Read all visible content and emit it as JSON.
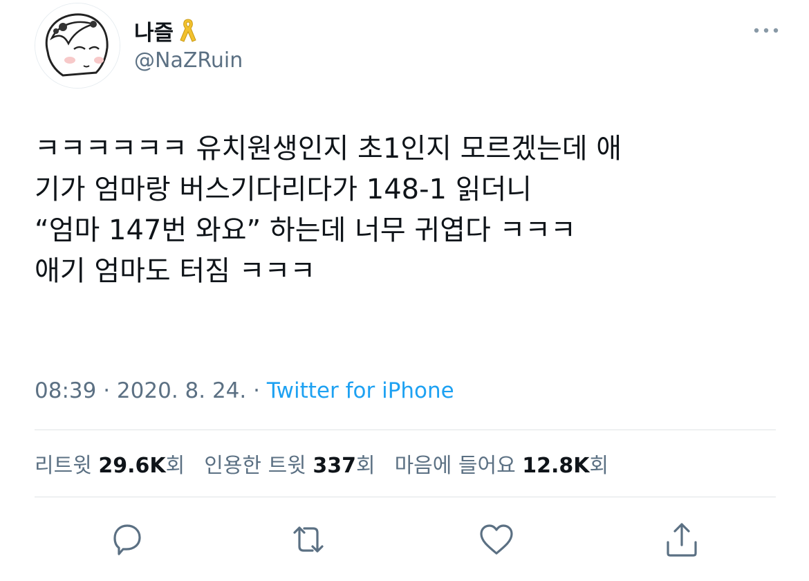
{
  "profile": {
    "display_name": "나즐",
    "handle": "@NaZRuin",
    "badge_icon": "yellow-ribbon-icon"
  },
  "tweet": {
    "lines": [
      "ㅋㅋㅋㅋㅋㅋ 유치원생인지 초1인지 모르겠는데 애",
      "기가 엄마랑 버스기다리다가 148-1 읽더니",
      "“엄마 147번 와요” 하는데 너무 귀엽다 ㅋㅋㅋ",
      "애기 엄마도 터짐 ㅋㅋㅋ"
    ]
  },
  "meta": {
    "time": "08:39",
    "separator": "·",
    "date": "2020. 8. 24.",
    "source": "Twitter for iPhone"
  },
  "stats": {
    "retweets_label": "리트윗",
    "retweets_count": "29.6K",
    "retweets_suffix": "회",
    "quotes_label": "인용한 트윗",
    "quotes_count": "337",
    "quotes_suffix": "회",
    "likes_label": "마음에 들어요",
    "likes_count": "12.8K",
    "likes_suffix": "회"
  },
  "actions": [
    "reply-icon",
    "retweet-icon",
    "like-icon",
    "share-icon"
  ],
  "colors": {
    "accent": "#1da1f2",
    "secondary_text": "#5b7083",
    "ribbon": "#f2c12e"
  }
}
